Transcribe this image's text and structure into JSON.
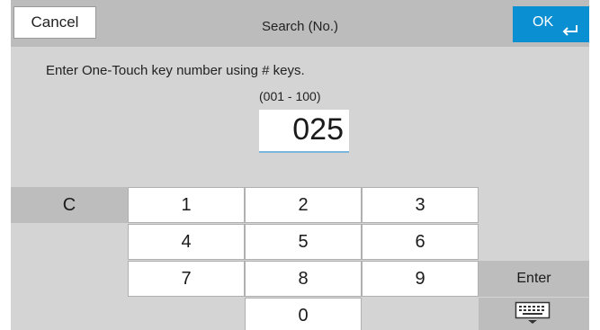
{
  "header": {
    "cancel_label": "Cancel",
    "title": "Search (No.)",
    "ok_label": "OK",
    "ok_icon": "enter-arrow-icon"
  },
  "entry": {
    "prompt": "Enter One-Touch key number using # keys.",
    "range": "(001 - 100)",
    "value": "025"
  },
  "keypad": {
    "clear_label": "C",
    "digits": [
      "1",
      "2",
      "3",
      "4",
      "5",
      "6",
      "7",
      "8",
      "9",
      "0"
    ],
    "enter_label": "Enter",
    "keyboard_icon": "keyboard-icon"
  },
  "colors": {
    "ok_button": "#0b8fd3",
    "header_bg": "#bcbcbc",
    "panel_bg": "#d4d4d4",
    "key_bg": "#ffffff"
  }
}
